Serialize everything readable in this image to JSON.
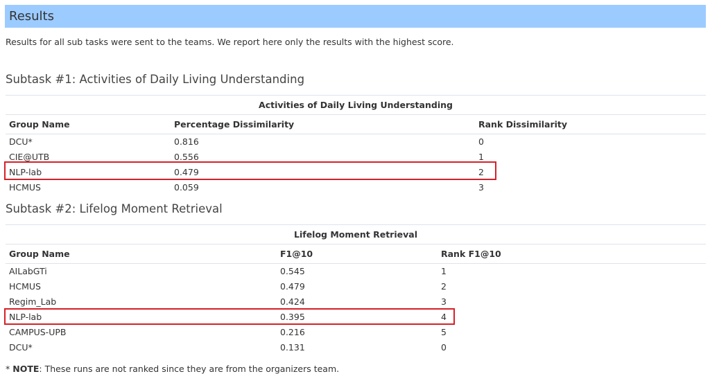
{
  "header": {
    "title": "Results"
  },
  "intro": "Results for all sub tasks were sent to the teams. We report here only the results with the highest score.",
  "subtasks": [
    {
      "title": "Subtask #1: Activities of Daily Living Understanding",
      "caption": "Activities of Daily Living Understanding",
      "columns": [
        "Group Name",
        "Percentage Dissimilarity",
        "Rank Dissimilarity"
      ],
      "rows": [
        [
          "DCU*",
          "0.816",
          "0"
        ],
        [
          "CIE@UTB",
          "0.556",
          "1"
        ],
        [
          "NLP-lab",
          "0.479",
          "2"
        ],
        [
          "HCMUS",
          "0.059",
          "3"
        ]
      ]
    },
    {
      "title": "Subtask #2: Lifelog Moment Retrieval",
      "caption": "Lifelog Moment Retrieval",
      "columns": [
        "Group Name",
        "F1@10",
        "Rank F1@10"
      ],
      "rows": [
        [
          "AILabGTi",
          "0.545",
          "1"
        ],
        [
          "HCMUS",
          "0.479",
          "2"
        ],
        [
          "Regim_Lab",
          "0.424",
          "3"
        ],
        [
          "NLP-lab",
          "0.395",
          "4"
        ],
        [
          "CAMPUS-UPB",
          "0.216",
          "5"
        ],
        [
          "DCU*",
          "0.131",
          "0"
        ]
      ]
    }
  ],
  "note": {
    "prefix": "* ",
    "label": "NOTE",
    "text": ": These runs are not ranked since they are from the organizers team."
  },
  "colors": {
    "header_bg": "#9ccbff",
    "highlight": "#d62027"
  }
}
